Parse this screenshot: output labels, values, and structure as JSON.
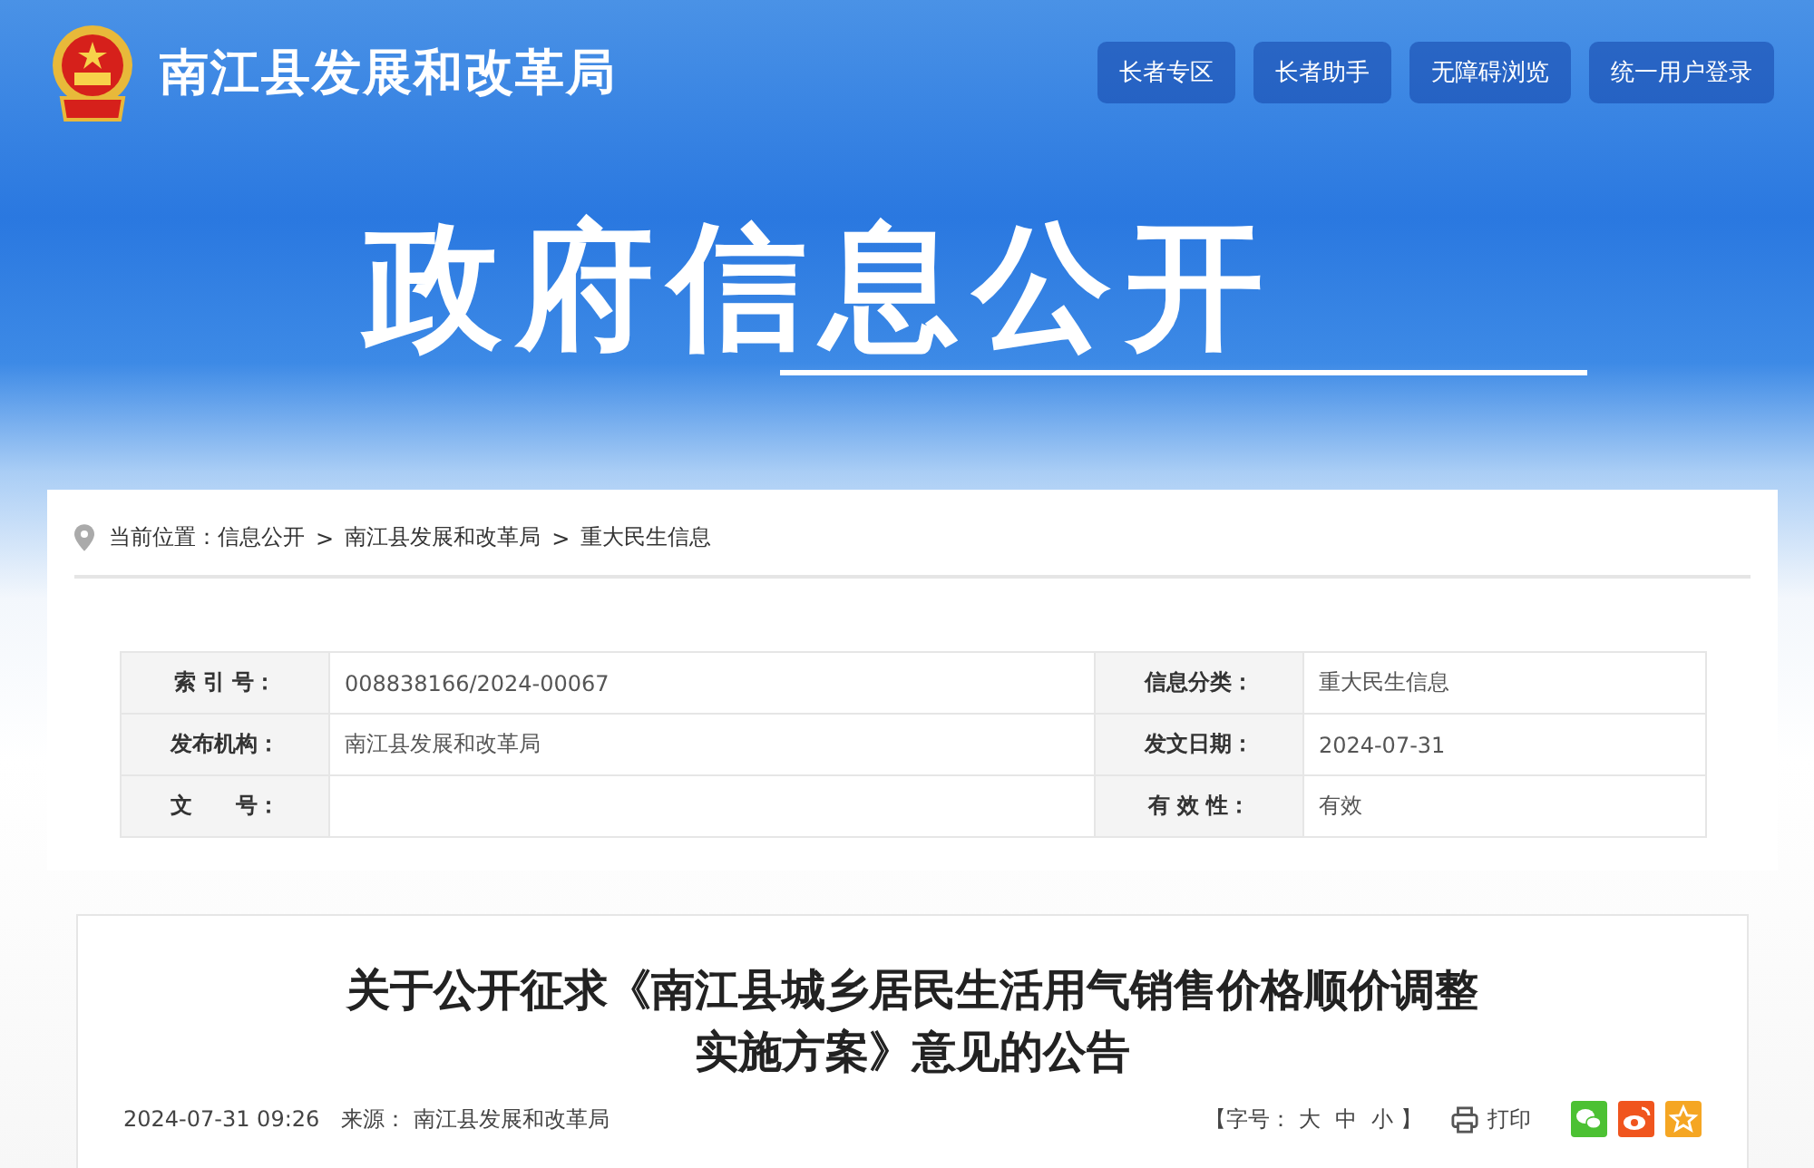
{
  "header": {
    "site_title": "南江县发展和改革局",
    "buttons": [
      "长者专区",
      "长者助手",
      "无障碍浏览",
      "统一用户登录"
    ]
  },
  "banner": {
    "title": "政府信息公开"
  },
  "breadcrumb": {
    "prefix": "当前位置：",
    "items": [
      "信息公开",
      "南江县发展和改革局",
      "重大民生信息"
    ],
    "separator": ">"
  },
  "info_table": {
    "rows": [
      [
        {
          "label": "索 引 号：",
          "value": "008838166/2024-00067"
        },
        {
          "label": "信息分类：",
          "value": "重大民生信息"
        }
      ],
      [
        {
          "label": "发布机构：",
          "value": "南江县发展和改革局"
        },
        {
          "label": "发文日期：",
          "value": "2024-07-31"
        }
      ],
      [
        {
          "label": "文　　号："
        },
        {
          "label": "有 效 性：",
          "value": "有效"
        }
      ]
    ]
  },
  "article": {
    "title_lines": [
      "关于公开征求《南江县城乡居民生活用气销售价格顺价调整",
      "实施方案》意见的公告"
    ],
    "date": "2024-07-31 09:26",
    "source_label": "来源：",
    "source": "南江县发展和改革局",
    "font_size": {
      "open": "【字号：",
      "options": [
        "大",
        "中",
        "小"
      ],
      "close": "】"
    },
    "print": "打印",
    "share": [
      {
        "kind": "wechat"
      },
      {
        "kind": "weibo"
      },
      {
        "kind": "favorite"
      }
    ]
  }
}
